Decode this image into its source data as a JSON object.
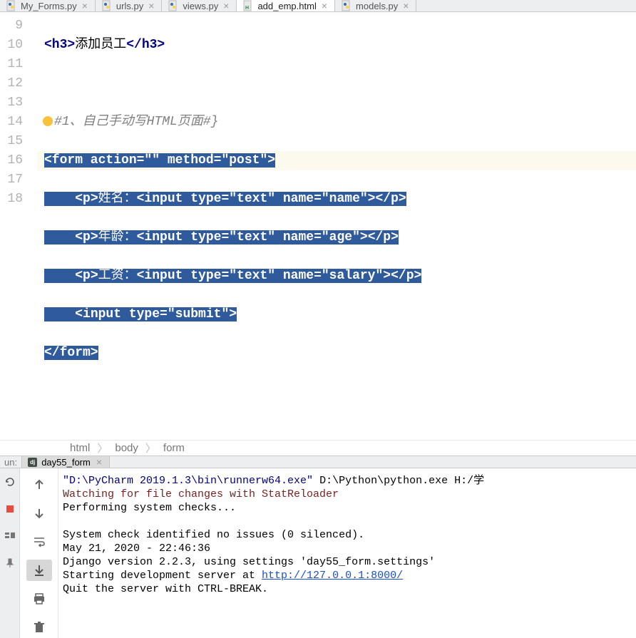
{
  "tabs": [
    {
      "label": "My_Forms.py",
      "icon": "python"
    },
    {
      "label": "urls.py",
      "icon": "python"
    },
    {
      "label": "views.py",
      "icon": "python"
    },
    {
      "label": "add_emp.html",
      "icon": "html",
      "active": true
    },
    {
      "label": "models.py",
      "icon": "python"
    }
  ],
  "gutter": {
    "start": 9,
    "lines": [
      "9",
      "10",
      "11",
      "12",
      "13",
      "14",
      "15",
      "16",
      "17",
      "18"
    ]
  },
  "code": {
    "l0_open": "<h3>",
    "l0_text": "添加员工",
    "l0_close": "</h3>",
    "l1_comment": "#1、自己手动写HTML页面#}",
    "l2": "<form action=\"\" method=\"post\">",
    "l3_open": "<p>",
    "l3_label": "姓名：",
    "l3_input": "<input type=\"text\" name=\"name\">",
    "l3_close": "</p>",
    "l4_open": "<p>",
    "l4_label": "年龄：",
    "l4_input": "<input type=\"text\" name=\"age\">",
    "l4_close": "</p>",
    "l5_open": "<p>",
    "l5_label": "工资：",
    "l5_input": "<input type=\"text\" name=\"salary\">",
    "l5_close": "</p>",
    "l6": "<input type=\"submit\">",
    "l7": "</form>"
  },
  "breadcrumb": [
    "html",
    "body",
    "form"
  ],
  "run": {
    "label": "un:",
    "tab": "day55_form"
  },
  "console": {
    "l1a": "\"D:\\PyCharm 2019.1.3\\bin\\runnerw64.exe\"",
    "l1b": " D:\\Python\\python.exe H:/学",
    "l2": "Watching for file changes with StatReloader",
    "l3": "Performing system checks...",
    "l4": "",
    "l5": "System check identified no issues (0 silenced).",
    "l6": "May 21, 2020 - 22:46:36",
    "l7": "Django version 2.2.3, using settings 'day55_form.settings'",
    "l8a": "Starting development server at ",
    "l8b": "http://127.0.0.1:8000/",
    "l9": "Quit the server with CTRL-BREAK."
  }
}
